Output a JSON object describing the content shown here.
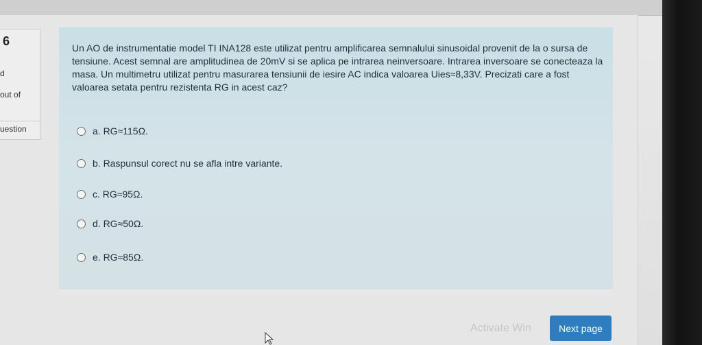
{
  "sidebar": {
    "question_number": "6",
    "line1": "d",
    "line2": "out of",
    "line3": "uestion"
  },
  "question": {
    "text": "Un AO de instrumentatie model TI INA128 este utilizat pentru amplificarea semnalului sinusoidal provenit de la o sursa de tensiune. Acest semnal are amplitudinea de 20mV si se aplica pe intrarea neinversoare. Intrarea inversoare se conecteaza la masa. Un multimetru utilizat pentru masurarea tensiunii de iesire AC indica valoarea Uies≈8,33V. Precizati care a fost valoarea setata pentru rezistenta RG in acest caz?",
    "answers": [
      "a. RG≈115Ω.",
      "b. Raspunsul corect nu se afla intre variante.",
      "c. RG≈95Ω.",
      "d. RG≈50Ω.",
      "e. RG≈85Ω."
    ]
  },
  "footer": {
    "next_label": "Next page",
    "watermark": "Activate Win"
  },
  "colors": {
    "formulation_bg": "#cfe1e7",
    "next_button": "#2f7cbf"
  }
}
